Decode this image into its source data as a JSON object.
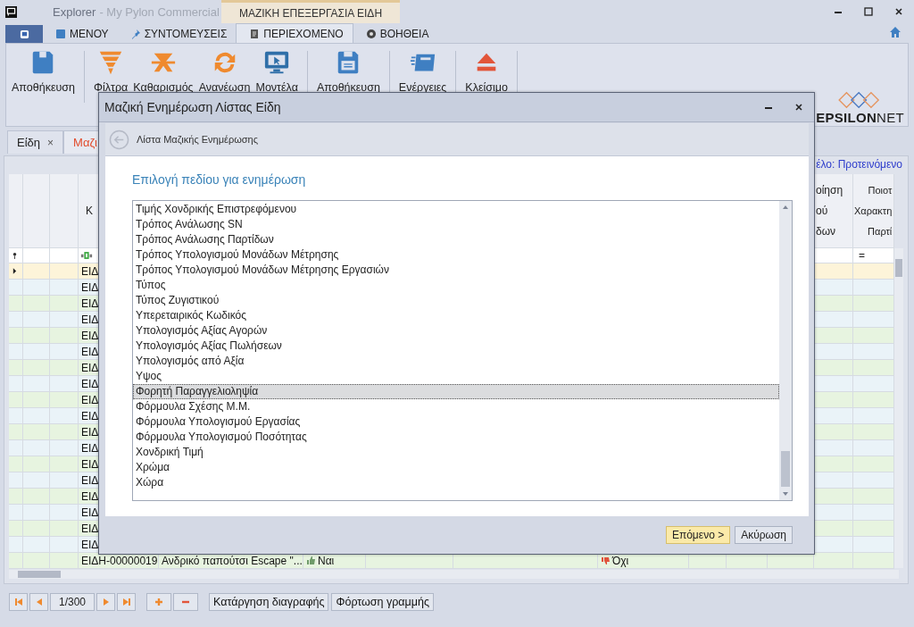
{
  "window": {
    "app_name": "Explorer",
    "title": "- My Pylon Commercial",
    "context_tab": "ΜΑΖΙΚΗ ΕΠΕΞΕΡΓΑΣΙΑ ΕΙΔΗ"
  },
  "ribbon_tabs": [
    {
      "label": "ΜΕΝΟΥ",
      "kind": "book",
      "selected": false
    },
    {
      "label": "ΣΥΝΤΟΜΕΥΣΕΙΣ",
      "kind": "pin",
      "selected": false
    },
    {
      "label": "ΠΕΡΙΕΧΟΜΕΝΟ",
      "kind": "document",
      "selected": true
    },
    {
      "label": "ΒΟΗΘΕΙΑ",
      "kind": "help",
      "selected": false
    }
  ],
  "ribbon_groups": [
    {
      "buttons": [
        {
          "label": "Αποθήκευση",
          "kind": "save"
        }
      ]
    },
    {
      "buttons": [
        {
          "label": "Φίλτρα",
          "kind": "filter"
        },
        {
          "label": "Καθαρισμός",
          "kind": "clear"
        },
        {
          "label": "Ανανέωση",
          "kind": "refresh"
        },
        {
          "label": "Μοντέλα",
          "kind": "monitor"
        }
      ]
    },
    {
      "buttons": [
        {
          "label": "Αποθήκευση",
          "kind": "save-list"
        }
      ]
    },
    {
      "buttons": [
        {
          "label": "Ενέργειες",
          "kind": "actions"
        }
      ]
    },
    {
      "buttons": [
        {
          "label": "Κλείσιμο",
          "kind": "eject"
        }
      ]
    }
  ],
  "logo": "**EPSILON**NET",
  "doc_tabs": [
    {
      "label": "Είδη",
      "close": "×",
      "selected": false
    },
    {
      "label": "Μαζι",
      "selected": true
    }
  ],
  "layout_label": "έλο: Προτεινόμενο",
  "grid": {
    "header": {
      "code": "Κ",
      "column_12": "οίηση\nού\nδων",
      "column_13": "Ποιοτ\nΧαρακτη\nΠαρτί"
    },
    "filter_operator": "=",
    "rows": [
      {
        "code": "ΕΙΔ",
        "selected": true
      },
      {
        "code": "ΕΙΔ",
        "selected": false
      },
      {
        "code": "ΕΙΔ",
        "selected": false
      },
      {
        "code": "ΕΙΔ",
        "selected": false
      },
      {
        "code": "ΕΙΔ",
        "selected": false
      },
      {
        "code": "ΕΙΔ",
        "selected": false
      },
      {
        "code": "ΕΙΔ",
        "selected": false
      },
      {
        "code": "ΕΙΔ",
        "selected": false
      },
      {
        "code": "ΕΙΔ",
        "selected": false
      },
      {
        "code": "ΕΙΔ",
        "selected": false
      },
      {
        "code": "ΕΙΔ",
        "selected": false
      },
      {
        "code": "ΕΙΔ",
        "selected": false
      },
      {
        "code": "ΕΙΔ",
        "selected": false
      },
      {
        "code": "ΕΙΔ",
        "selected": false
      },
      {
        "code": "ΕΙΔ",
        "selected": false
      },
      {
        "code": "ΕΙΔ",
        "selected": false
      },
      {
        "code": "ΕΙΔ",
        "selected": false
      },
      {
        "code": "ΕΙΔ",
        "selected": false
      },
      {
        "code": "ΕΙΔΗ-00000019",
        "description": "Ανδρικό παπούτσι  Escape \"...",
        "flag_1": {
          "text": "Ναι",
          "positive": true
        },
        "flag_2": {
          "text": "Όχι",
          "positive": false
        },
        "selected": false
      }
    ]
  },
  "dialog": {
    "title": "Μαζική Ενημέρωση Λίστας Είδη",
    "step": "Λίστα Μαζικής Ενημέρωσης",
    "heading": "Επιλογή πεδίου για ενημέρωση",
    "fields": [
      {
        "label": "Τιμής Χονδρικής Επιστρεφόμενου",
        "selected": false
      },
      {
        "label": "Τρόπος Ανάλωσης SN",
        "selected": false
      },
      {
        "label": "Τρόπος Ανάλωσης Παρτίδων",
        "selected": false
      },
      {
        "label": "Τρόπος Υπολογισμού Μονάδων Μέτρησης",
        "selected": false
      },
      {
        "label": "Τρόπος Υπολογισμού Μονάδων Μέτρησης Εργασιών",
        "selected": false
      },
      {
        "label": "Τύπος",
        "selected": false
      },
      {
        "label": "Τύπος Ζυγιστικού",
        "selected": false
      },
      {
        "label": "Υπερεταιρικός Κωδικός",
        "selected": false
      },
      {
        "label": "Υπολογισμός Αξίας Αγορών",
        "selected": false
      },
      {
        "label": "Υπολογισμός Αξίας Πωλήσεων",
        "selected": false
      },
      {
        "label": "Υπολογισμός από Αξία",
        "selected": false
      },
      {
        "label": "Υψος",
        "selected": false
      },
      {
        "label": "Φορητή Παραγγελιοληψία",
        "selected": true
      },
      {
        "label": "Φόρμουλα Σχέσης Μ.Μ.",
        "selected": false
      },
      {
        "label": "Φόρμουλα Υπολογισμού Εργασίας",
        "selected": false
      },
      {
        "label": "Φόρμουλα Υπολογισμού Ποσότητας",
        "selected": false
      },
      {
        "label": "Χονδρική Τιμή",
        "selected": false
      },
      {
        "label": "Χρώμα",
        "selected": false
      },
      {
        "label": "Χώρα",
        "selected": false
      }
    ],
    "buttons": [
      {
        "label": "Επόμενο >",
        "kind": "default"
      },
      {
        "label": "Ακύρωση",
        "kind": "normal"
      }
    ]
  },
  "pager": {
    "position": "1/300",
    "actions": [
      "Κατάργηση διαγραφής",
      "Φόρτωση γραμμής"
    ]
  }
}
